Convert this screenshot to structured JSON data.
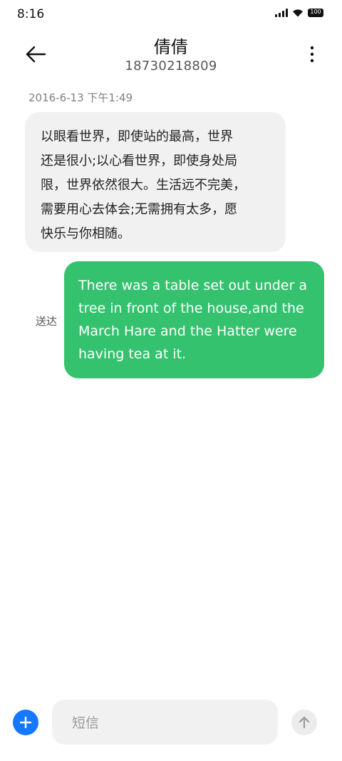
{
  "status_bar": {
    "time": "8:16",
    "battery": "100",
    "icons": [
      "signal-icon",
      "wifi-icon",
      "battery-icon"
    ]
  },
  "header": {
    "contact_name": "倩倩",
    "contact_number": "18730218809",
    "back_icon": "arrow-left-icon",
    "more_icon": "more-vertical-icon"
  },
  "conversation": {
    "timestamp": "2016-6-13 下午1:49",
    "incoming": {
      "lines": [
        "以眼看世界，即使站的最高，世界",
        "还是很小;以心看世界，即使身处局",
        "限，世界依然很大。生活远不完美，",
        "需要用心去体会;无需拥有太多，愿",
        "快乐与你相随。"
      ]
    },
    "outgoing": {
      "lines": [
        "There was a table set out under a",
        "tree in front of the house,and the",
        "March Hare and the Hatter were",
        "having tea at it."
      ],
      "status": "送达"
    }
  },
  "composer": {
    "placeholder": "短信",
    "add_icon": "plus-icon",
    "send_icon": "arrow-up-icon"
  },
  "colors": {
    "outgoing_bubble": "#34c26e",
    "incoming_bubble": "#f1f1f1",
    "accent": "#1677ff"
  }
}
